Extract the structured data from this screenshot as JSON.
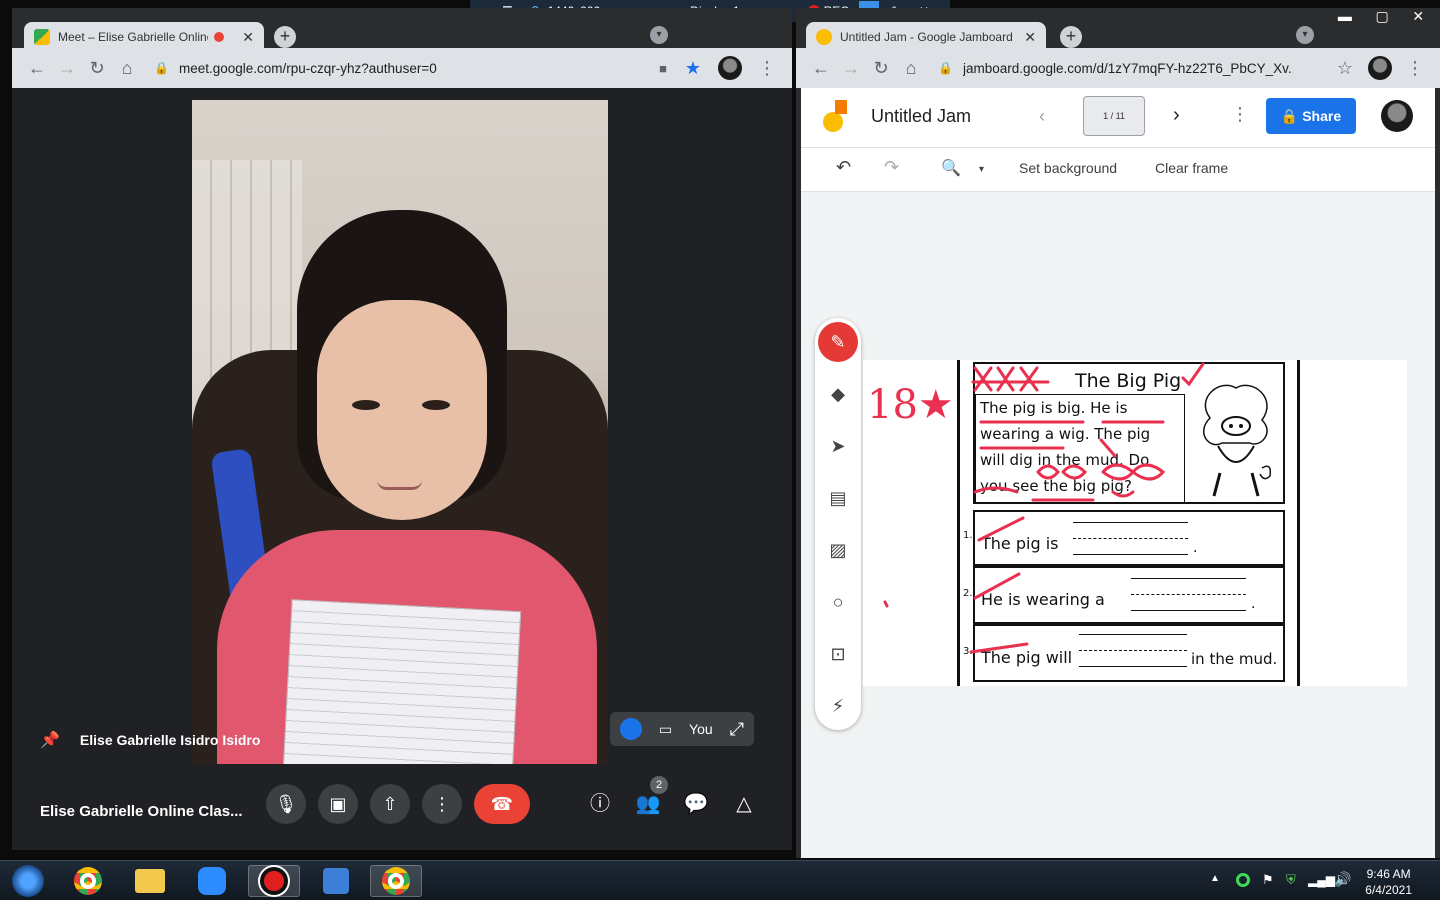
{
  "recorder": {
    "resolution": "1440x900",
    "display": "Display 1",
    "rec": "REC"
  },
  "meet_window": {
    "tab_title": "Meet – Elise Gabrielle Online",
    "url": "meet.google.com/rpu-czqr-yhz?authuser=0",
    "participant_name": "Elise Gabrielle Isidro Isidro",
    "self_label": "You",
    "meeting_title": "Elise Gabrielle Online Clas...",
    "participant_count": "2"
  },
  "jam_window": {
    "tab_title": "Untitled Jam - Google Jamboard",
    "url": "jamboard.google.com/d/1zY7mqFY-hz22T6_PbCY_Xv...",
    "doc_title": "Untitled Jam",
    "frame_indicator": "1 / 11",
    "share_label": "Share",
    "toolbar": {
      "set_background": "Set background",
      "clear_frame": "Clear frame"
    }
  },
  "worksheet": {
    "score_mark": "18★",
    "title": "The Big Pig",
    "passage": [
      "The pig is big.  He is",
      "wearing a wig.  The pig",
      "will dig in the mud.  Do",
      "you see the big pig?"
    ],
    "questions": [
      {
        "num": "1.",
        "prefix": "The pig is",
        "suffix": "."
      },
      {
        "num": "2.",
        "prefix": "He is wearing a",
        "suffix": "."
      },
      {
        "num": "3.",
        "prefix": "The pig will",
        "suffix": "in the mud."
      }
    ]
  },
  "taskbar": {
    "time": "9:46 AM",
    "date": "6/4/2021"
  },
  "colors": {
    "meet_bg": "#202124",
    "share_blue": "#1a73e8",
    "end_call_red": "#ea4335",
    "pen_red": "#e53935"
  }
}
